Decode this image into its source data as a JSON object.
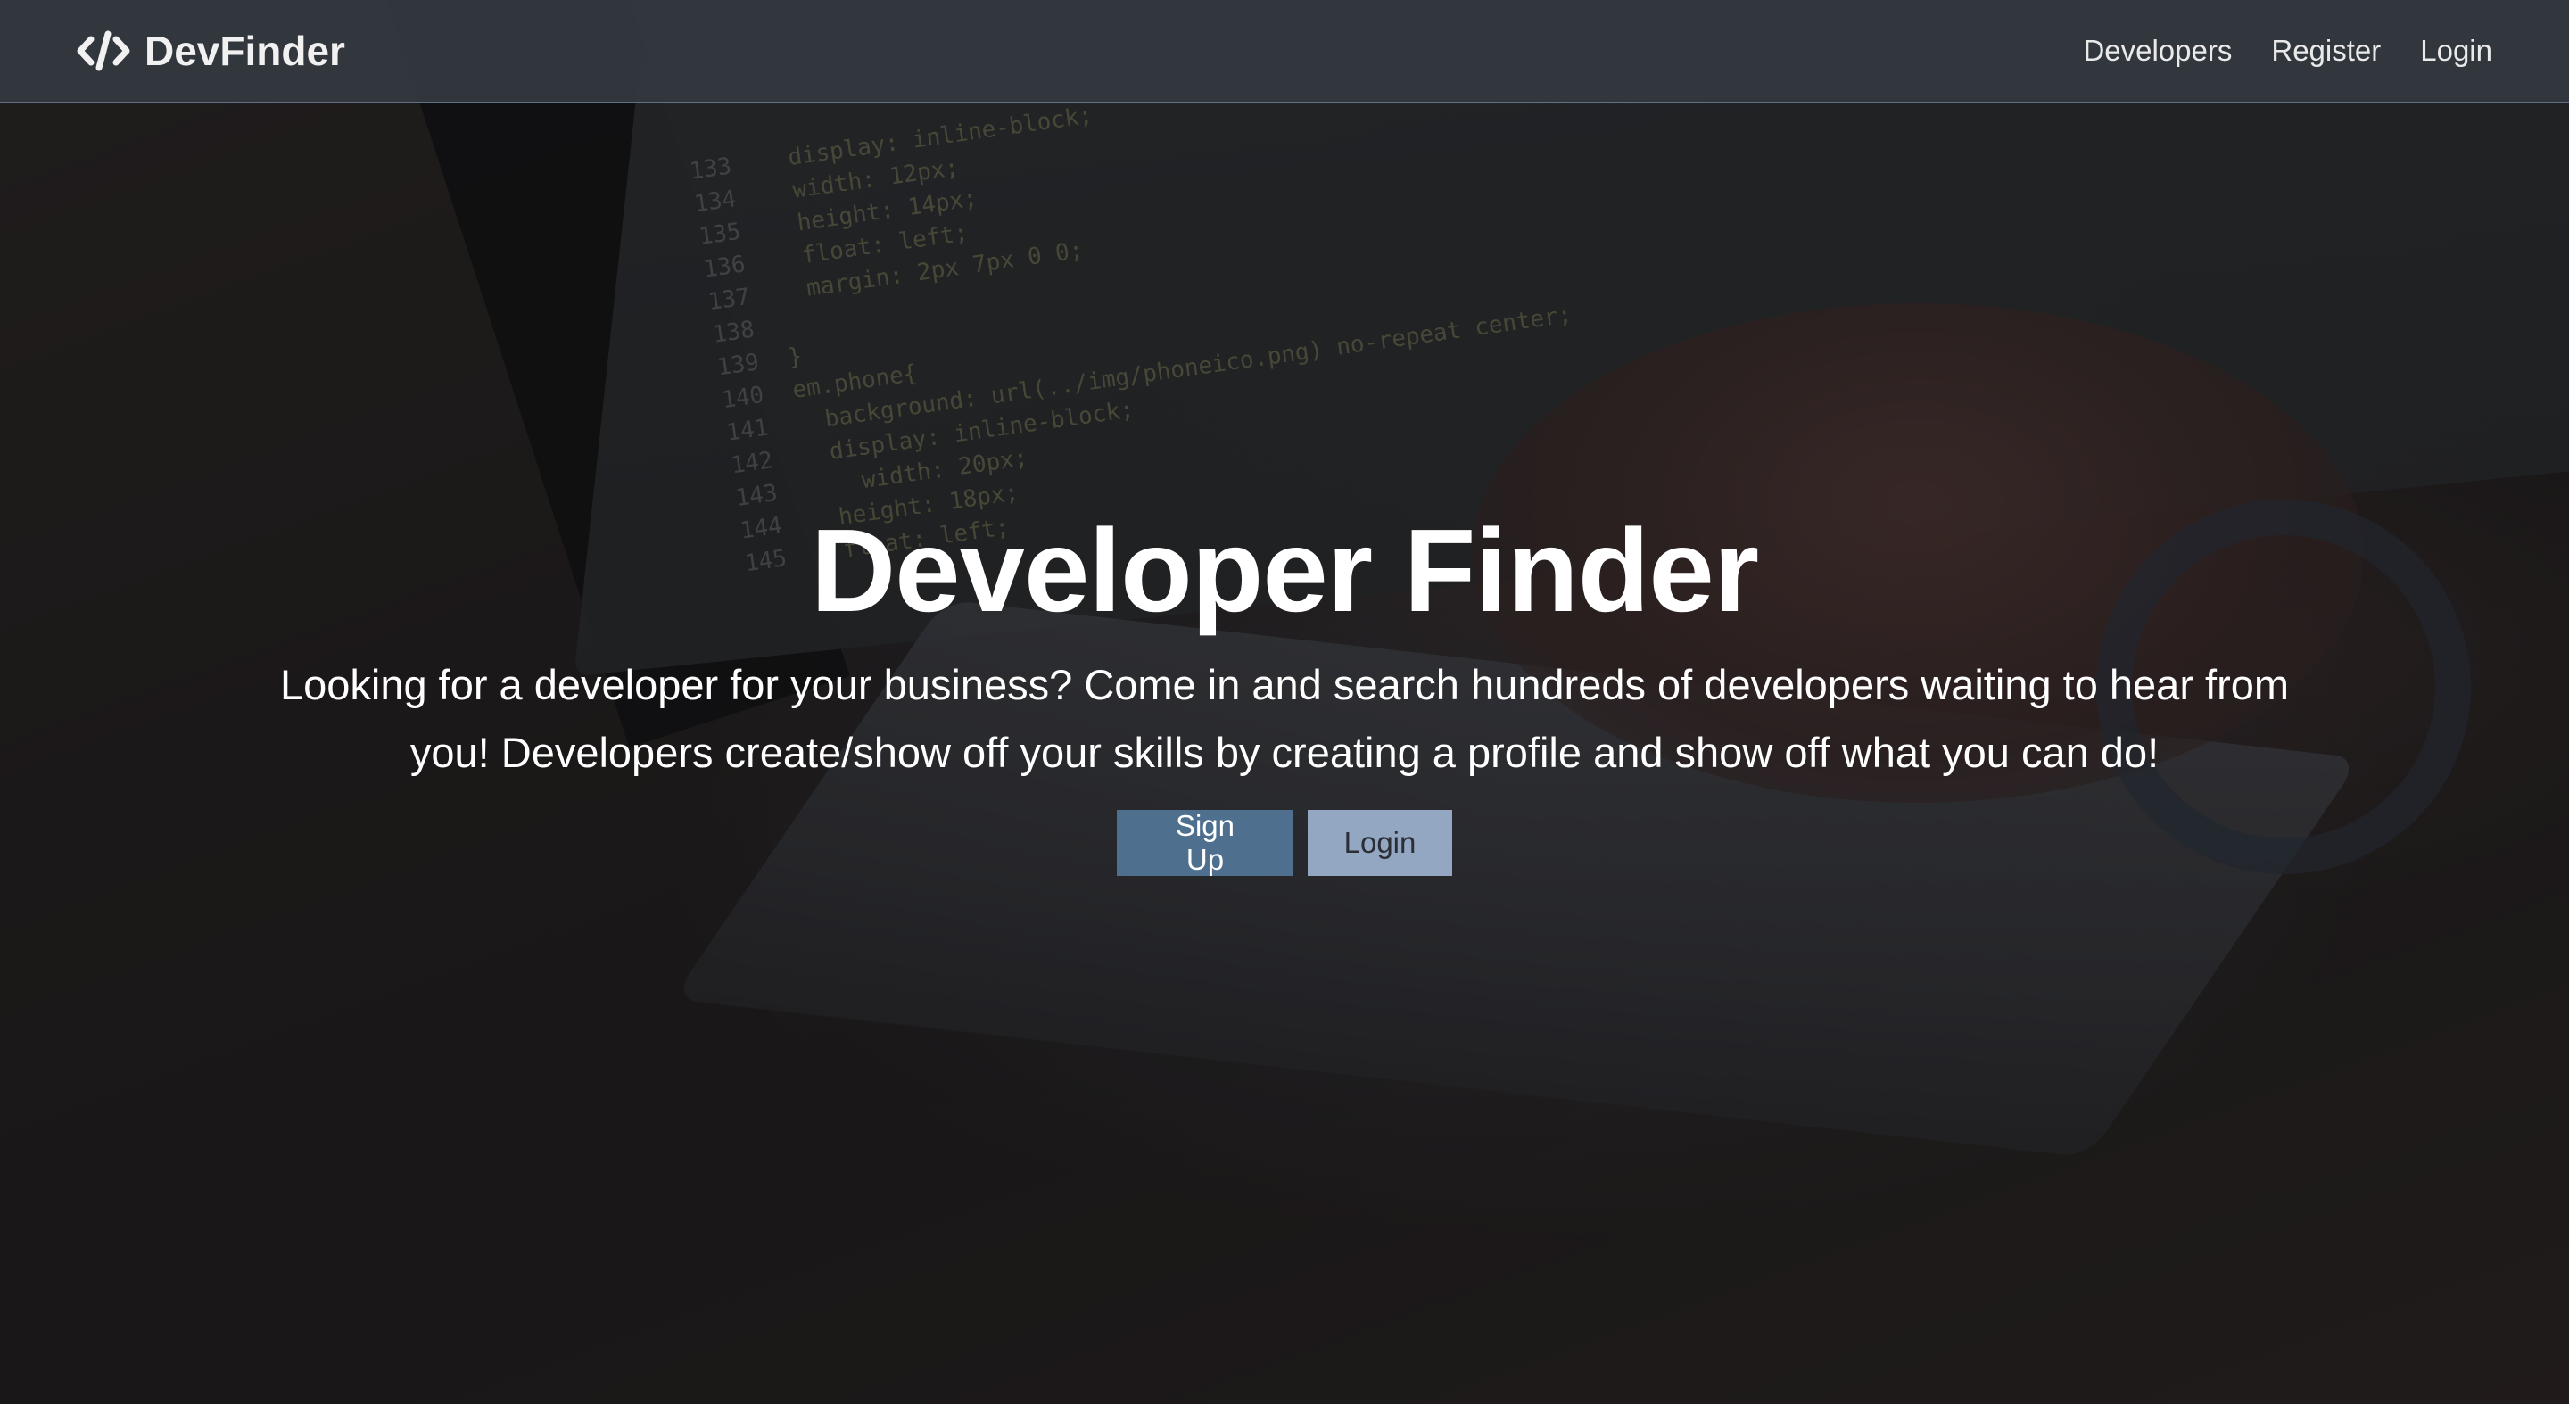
{
  "navbar": {
    "brand": {
      "icon": "code-slash-icon",
      "text": "DevFinder"
    },
    "links": [
      {
        "label": "Developers"
      },
      {
        "label": "Register"
      },
      {
        "label": "Login"
      }
    ]
  },
  "hero": {
    "title": "Developer Finder",
    "lead": "Looking for a developer for your business? Come in and search hundreds of developers waiting to hear from you! Developers create/show off your skills by creating a profile and show off what you can do!",
    "buttons": {
      "signup_label": "Sign Up",
      "login_label": "Login"
    }
  },
  "background_code_lines": [
    {
      "num": "133",
      "text": "  display: inline-block;"
    },
    {
      "num": "134",
      "text": "  width: 12px;"
    },
    {
      "num": "135",
      "text": "  height: 14px;"
    },
    {
      "num": "136",
      "text": "  float: left;"
    },
    {
      "num": "137",
      "text": "  margin: 2px 7px 0 0;"
    },
    {
      "num": "138",
      "text": ""
    },
    {
      "num": "139",
      "text": "}"
    },
    {
      "num": "140",
      "text": "em.phone{"
    },
    {
      "num": "141",
      "text": "  background: url(../img/phoneico.png) no-repeat center;"
    },
    {
      "num": "142",
      "text": "  display: inline-block;"
    },
    {
      "num": "143",
      "text": "    width: 20px;"
    },
    {
      "num": "144",
      "text": "  height: 18px;"
    },
    {
      "num": "145",
      "text": "  float: left;"
    }
  ],
  "colors": {
    "navbar_bg": "#343a40",
    "primary_button": "#4f6f8f",
    "light_button": "#93a6c2",
    "text": "#ffffff"
  }
}
